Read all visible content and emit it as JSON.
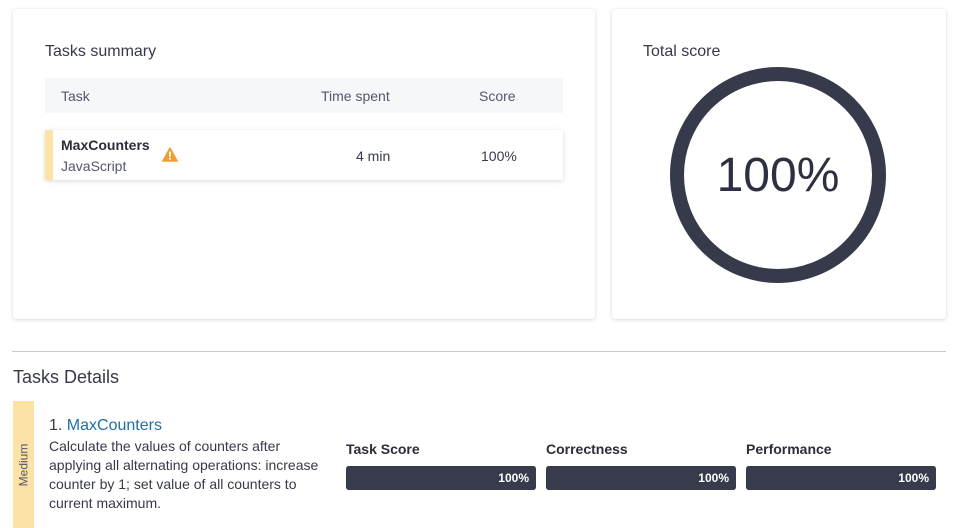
{
  "summary": {
    "title": "Tasks summary",
    "columns": {
      "task": "Task",
      "time": "Time spent",
      "score": "Score"
    },
    "rows": [
      {
        "name": "MaxCounters",
        "language": "JavaScript",
        "time": "4 min",
        "score": "100%",
        "warning_icon": "warning-triangle-icon"
      }
    ]
  },
  "total_score": {
    "title": "Total score",
    "value_text": "100%",
    "value": 100,
    "ring_color": "#363a4b"
  },
  "details": {
    "title": "Tasks Details",
    "tasks": [
      {
        "difficulty": "Medium",
        "number": "1.",
        "name": "MaxCounters",
        "description": "Calculate the values of counters after applying all alternating operations: increase counter by 1; set value of all counters to current maximum.",
        "metrics": [
          {
            "label": "Task Score",
            "value_text": "100%",
            "value": 100
          },
          {
            "label": "Correctness",
            "value_text": "100%",
            "value": 100
          },
          {
            "label": "Performance",
            "value_text": "100%",
            "value": 100
          }
        ]
      }
    ]
  },
  "colors": {
    "accent_medium": "#fde2a6",
    "link": "#1f6ea9",
    "bar": "#383b4c",
    "warning": "#f0a030"
  }
}
